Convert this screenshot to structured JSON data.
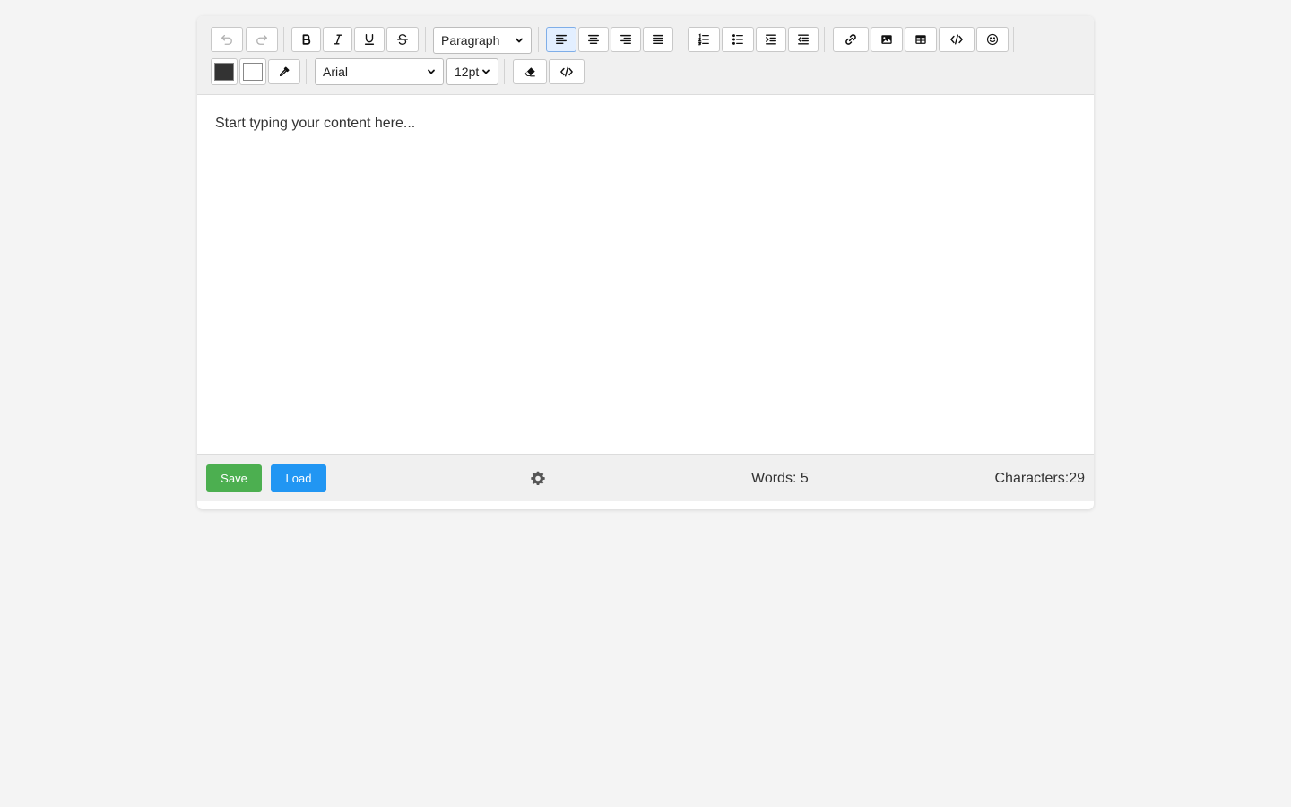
{
  "toolbar": {
    "row1": {
      "undo": {
        "icon": "undo-icon",
        "disabled": true
      },
      "redo": {
        "icon": "redo-icon",
        "disabled": true
      },
      "bold": {
        "icon": "bold-icon"
      },
      "italic": {
        "icon": "italic-icon"
      },
      "underline": {
        "icon": "underline-icon"
      },
      "strikethrough": {
        "icon": "strikethrough-icon"
      },
      "block_format": {
        "selected": "Paragraph"
      },
      "align_left": {
        "icon": "align-left-icon",
        "active": true
      },
      "align_center": {
        "icon": "align-center-icon"
      },
      "align_right": {
        "icon": "align-right-icon"
      },
      "align_justify": {
        "icon": "align-justify-icon"
      },
      "ordered_list": {
        "icon": "ordered-list-icon"
      },
      "unordered_list": {
        "icon": "unordered-list-icon"
      },
      "indent": {
        "icon": "indent-icon"
      },
      "outdent": {
        "icon": "outdent-icon"
      },
      "link": {
        "icon": "link-icon"
      },
      "image": {
        "icon": "image-icon"
      },
      "table": {
        "icon": "table-icon"
      },
      "code": {
        "icon": "code-icon"
      },
      "emoji": {
        "icon": "emoji-icon"
      }
    },
    "row2": {
      "text_color": {
        "color": "#333333"
      },
      "background_color": {
        "color": "#ffffff"
      },
      "eyedropper": {
        "icon": "eyedropper-icon"
      },
      "font_family": {
        "selected": "Arial"
      },
      "font_size": {
        "selected": "12pt"
      },
      "clear_format": {
        "icon": "eraser-icon"
      },
      "source_code": {
        "icon": "code-icon"
      }
    }
  },
  "editor": {
    "placeholder": "Start typing your content here..."
  },
  "footer": {
    "save_label": "Save",
    "load_label": "Load",
    "settings_icon": "gear-icon",
    "words_label": "Words: 5",
    "characters_label": "Characters:29"
  },
  "colors": {
    "save": "#4caf50",
    "load": "#2196f3",
    "page_bg": "#f4f4f4",
    "toolbar_bg": "#f0f0f0"
  }
}
